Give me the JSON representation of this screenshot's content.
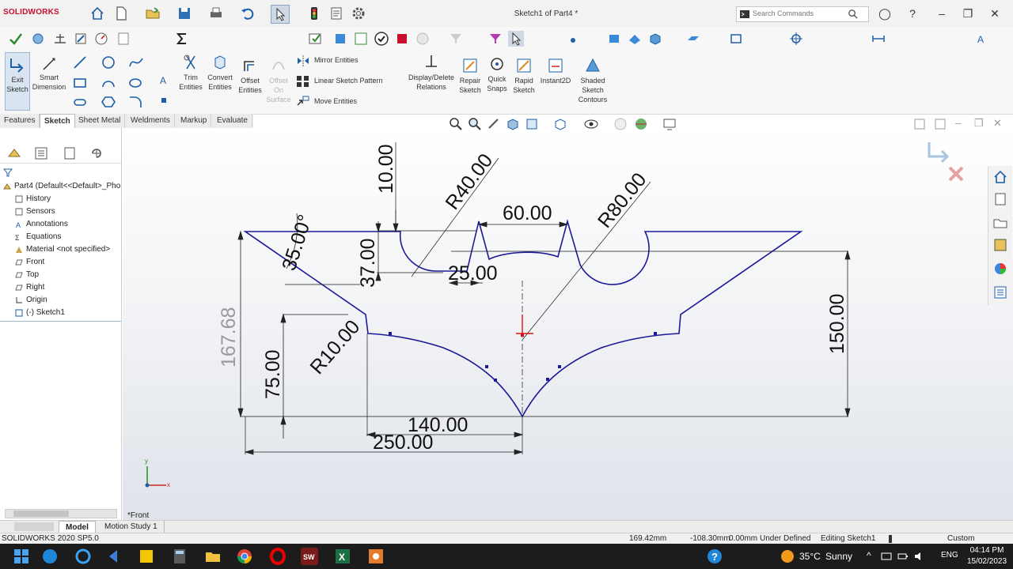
{
  "app": {
    "logo_text": "SOLIDWORKS",
    "document_title": "Sketch1 of Part4 *",
    "search_placeholder": "Search Commands"
  },
  "ribbon": {
    "exit_sketch": "Exit Sketch",
    "smart_dimension": "Smart Dimension",
    "trim_entities": "Trim Entities",
    "convert_entities": "Convert Entities",
    "offset_entities": "Offset Entities",
    "offset_on_surface": "Offset On Surface",
    "mirror_entities": "Mirror Entities",
    "linear_sketch_pattern": "Linear Sketch Pattern",
    "move_entities": "Move Entities",
    "display_delete_relations": "Display/Delete Relations",
    "repair_sketch": "Repair Sketch",
    "quick_snaps": "Quick Snaps",
    "rapid_sketch": "Rapid Sketch",
    "instant2d": "Instant2D",
    "shaded_sketch_contours": "Shaded Sketch Contours"
  },
  "tabs": [
    "Features",
    "Sketch",
    "Sheet Metal",
    "Weldments",
    "Markup",
    "Evaluate"
  ],
  "active_tab": "Sketch",
  "tree": {
    "root": "Part4  (Default<<Default>_Pho",
    "items": [
      "History",
      "Sensors",
      "Annotations",
      "Equations",
      "Material <not specified>",
      "Front",
      "Top",
      "Right",
      "Origin",
      "(-) Sketch1"
    ]
  },
  "view": {
    "orientation_label": "*Front",
    "triad_x": "x",
    "triad_y": "y"
  },
  "dimensions": {
    "d10": "10.00",
    "r40": "R40.00",
    "d60": "60.00",
    "r80": "R80.00",
    "a35": "35.00°",
    "d37": "37.00",
    "d25": "25.00",
    "d167": "167.68",
    "d150": "150.00",
    "r10": "R10.00",
    "d75": "75.00",
    "d140": "140.00",
    "d250": "250.00"
  },
  "bottom_tabs": [
    "Model",
    "Motion Study 1"
  ],
  "status": {
    "version": "SOLIDWORKS 2020 SP5.0",
    "x": "169.42mm",
    "y": "-108.30mm",
    "z": "0.00mm",
    "state": "Under Defined",
    "editing": "Editing Sketch1",
    "units": "Custom"
  },
  "taskbar": {
    "temperature": "35°C",
    "weather": "Sunny",
    "lang": "ENG",
    "time": "04:14 PM",
    "date": "15/02/2023"
  },
  "colors": {
    "sketch_line": "#1a1a9a",
    "dimension": "#111111",
    "sw_red": "#c8102e",
    "taskbar": "#1c1c1c"
  }
}
